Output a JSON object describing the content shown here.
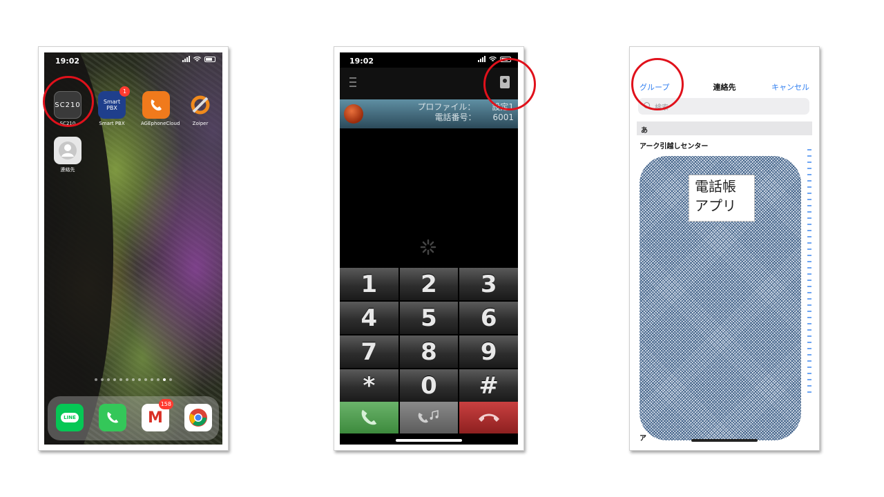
{
  "phone1": {
    "status_time": "19:02",
    "apps": [
      {
        "label": "SC210",
        "icon_text": "SC210"
      },
      {
        "label": "Smart PBX",
        "icon_text": "Smart PBX",
        "badge": "1"
      },
      {
        "label": "AGEphoneCloud",
        "icon_text": ""
      },
      {
        "label": "Zoiper",
        "icon_text": ""
      },
      {
        "label": "連絡先",
        "icon_text": ""
      }
    ],
    "dock": [
      {
        "name": "LINE",
        "icon_text": "LINE"
      },
      {
        "name": "Phone",
        "icon_text": ""
      },
      {
        "name": "Gmail",
        "icon_text": "M",
        "badge": "158"
      },
      {
        "name": "Chrome",
        "icon_text": ""
      }
    ]
  },
  "phone2": {
    "status_time": "19:02",
    "profile_label": "プロファイル：",
    "profile_value": "設定1",
    "number_label": "電話番号：",
    "number_value": "6001",
    "keys": [
      "1",
      "2",
      "3",
      "4",
      "5",
      "6",
      "7",
      "8",
      "9",
      "*",
      "0",
      "#"
    ]
  },
  "phone3": {
    "nav_left": "グループ",
    "nav_title": "連絡先",
    "nav_right": "キャンセル",
    "search_placeholder": "検索",
    "section": "あ",
    "first_contact": "アーク引越しセンター",
    "last_contact_partial": "ア",
    "overlay_label_line1": "電話帳",
    "overlay_label_line2": "アプリ"
  },
  "colors": {
    "annotation_red": "#e0111b",
    "ios_blue": "#2f7ef0"
  }
}
